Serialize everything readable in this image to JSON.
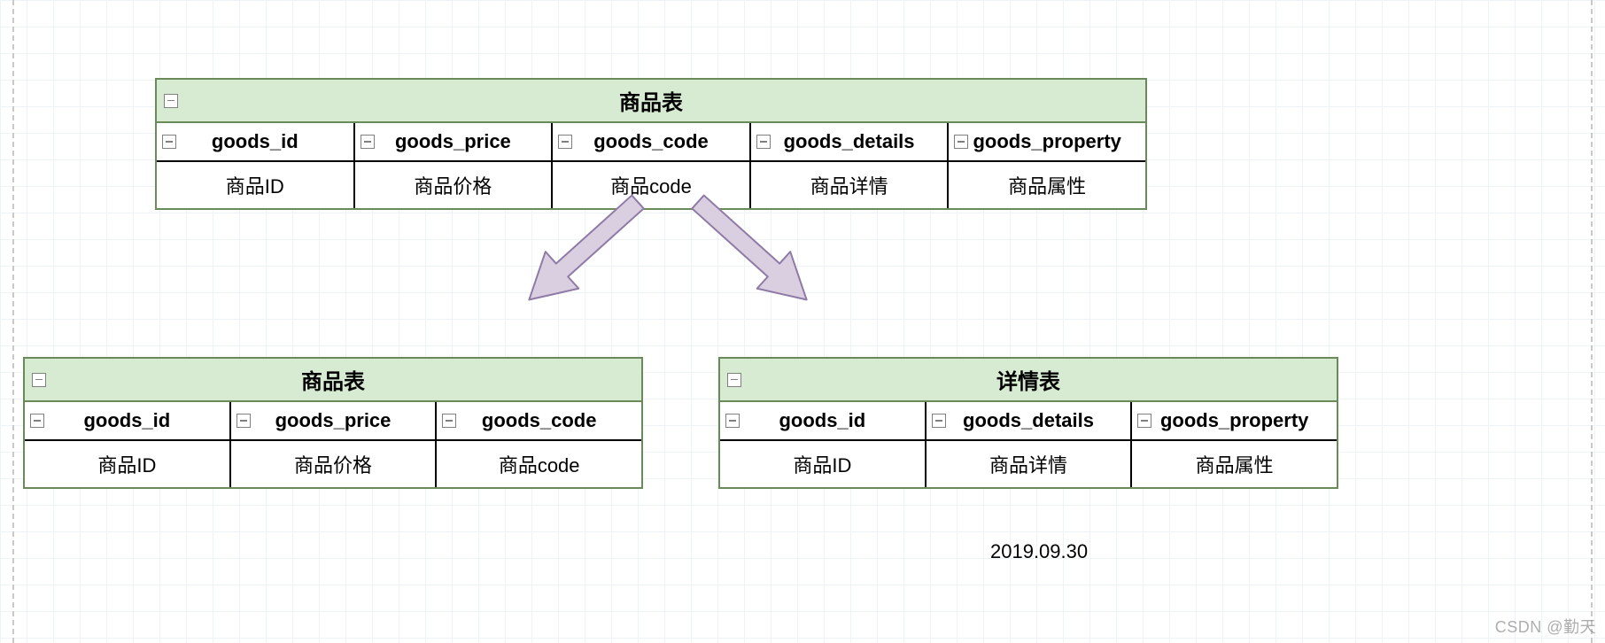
{
  "colors": {
    "table_border": "#6a8a5a",
    "table_header_bg": "#d7ead2",
    "arrow_fill": "#d9cfe1",
    "arrow_stroke": "#8f7aa5"
  },
  "top_table": {
    "title": "商品表",
    "columns": [
      {
        "name": "goods_id",
        "label": "商品ID"
      },
      {
        "name": "goods_price",
        "label": "商品价格"
      },
      {
        "name": "goods_code",
        "label": "商品code"
      },
      {
        "name": "goods_details",
        "label": "商品详情"
      },
      {
        "name": "goods_property",
        "label": "商品属性"
      }
    ]
  },
  "left_table": {
    "title": "商品表",
    "columns": [
      {
        "name": "goods_id",
        "label": "商品ID"
      },
      {
        "name": "goods_price",
        "label": "商品价格"
      },
      {
        "name": "goods_code",
        "label": "商品code"
      }
    ]
  },
  "right_table": {
    "title": "详情表",
    "columns": [
      {
        "name": "goods_id",
        "label": "商品ID"
      },
      {
        "name": "goods_details",
        "label": "商品详情"
      },
      {
        "name": "goods_property",
        "label": "商品属性"
      }
    ]
  },
  "date": "2019.09.30",
  "watermark": "CSDN @勤天"
}
